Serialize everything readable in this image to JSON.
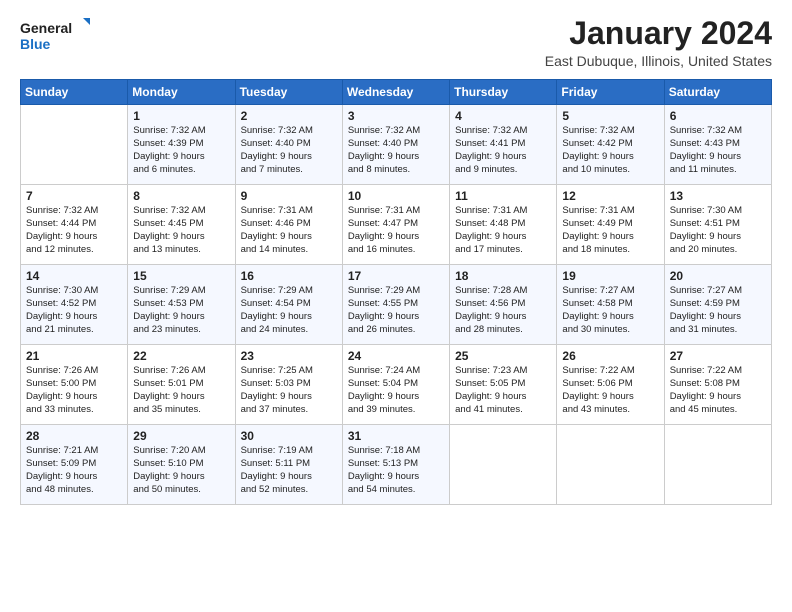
{
  "header": {
    "logo_line1": "General",
    "logo_line2": "Blue",
    "title": "January 2024",
    "subtitle": "East Dubuque, Illinois, United States"
  },
  "weekdays": [
    "Sunday",
    "Monday",
    "Tuesday",
    "Wednesday",
    "Thursday",
    "Friday",
    "Saturday"
  ],
  "weeks": [
    [
      {
        "day": "",
        "info": ""
      },
      {
        "day": "1",
        "info": "Sunrise: 7:32 AM\nSunset: 4:39 PM\nDaylight: 9 hours\nand 6 minutes."
      },
      {
        "day": "2",
        "info": "Sunrise: 7:32 AM\nSunset: 4:40 PM\nDaylight: 9 hours\nand 7 minutes."
      },
      {
        "day": "3",
        "info": "Sunrise: 7:32 AM\nSunset: 4:40 PM\nDaylight: 9 hours\nand 8 minutes."
      },
      {
        "day": "4",
        "info": "Sunrise: 7:32 AM\nSunset: 4:41 PM\nDaylight: 9 hours\nand 9 minutes."
      },
      {
        "day": "5",
        "info": "Sunrise: 7:32 AM\nSunset: 4:42 PM\nDaylight: 9 hours\nand 10 minutes."
      },
      {
        "day": "6",
        "info": "Sunrise: 7:32 AM\nSunset: 4:43 PM\nDaylight: 9 hours\nand 11 minutes."
      }
    ],
    [
      {
        "day": "7",
        "info": "Sunrise: 7:32 AM\nSunset: 4:44 PM\nDaylight: 9 hours\nand 12 minutes."
      },
      {
        "day": "8",
        "info": "Sunrise: 7:32 AM\nSunset: 4:45 PM\nDaylight: 9 hours\nand 13 minutes."
      },
      {
        "day": "9",
        "info": "Sunrise: 7:31 AM\nSunset: 4:46 PM\nDaylight: 9 hours\nand 14 minutes."
      },
      {
        "day": "10",
        "info": "Sunrise: 7:31 AM\nSunset: 4:47 PM\nDaylight: 9 hours\nand 16 minutes."
      },
      {
        "day": "11",
        "info": "Sunrise: 7:31 AM\nSunset: 4:48 PM\nDaylight: 9 hours\nand 17 minutes."
      },
      {
        "day": "12",
        "info": "Sunrise: 7:31 AM\nSunset: 4:49 PM\nDaylight: 9 hours\nand 18 minutes."
      },
      {
        "day": "13",
        "info": "Sunrise: 7:30 AM\nSunset: 4:51 PM\nDaylight: 9 hours\nand 20 minutes."
      }
    ],
    [
      {
        "day": "14",
        "info": "Sunrise: 7:30 AM\nSunset: 4:52 PM\nDaylight: 9 hours\nand 21 minutes."
      },
      {
        "day": "15",
        "info": "Sunrise: 7:29 AM\nSunset: 4:53 PM\nDaylight: 9 hours\nand 23 minutes."
      },
      {
        "day": "16",
        "info": "Sunrise: 7:29 AM\nSunset: 4:54 PM\nDaylight: 9 hours\nand 24 minutes."
      },
      {
        "day": "17",
        "info": "Sunrise: 7:29 AM\nSunset: 4:55 PM\nDaylight: 9 hours\nand 26 minutes."
      },
      {
        "day": "18",
        "info": "Sunrise: 7:28 AM\nSunset: 4:56 PM\nDaylight: 9 hours\nand 28 minutes."
      },
      {
        "day": "19",
        "info": "Sunrise: 7:27 AM\nSunset: 4:58 PM\nDaylight: 9 hours\nand 30 minutes."
      },
      {
        "day": "20",
        "info": "Sunrise: 7:27 AM\nSunset: 4:59 PM\nDaylight: 9 hours\nand 31 minutes."
      }
    ],
    [
      {
        "day": "21",
        "info": "Sunrise: 7:26 AM\nSunset: 5:00 PM\nDaylight: 9 hours\nand 33 minutes."
      },
      {
        "day": "22",
        "info": "Sunrise: 7:26 AM\nSunset: 5:01 PM\nDaylight: 9 hours\nand 35 minutes."
      },
      {
        "day": "23",
        "info": "Sunrise: 7:25 AM\nSunset: 5:03 PM\nDaylight: 9 hours\nand 37 minutes."
      },
      {
        "day": "24",
        "info": "Sunrise: 7:24 AM\nSunset: 5:04 PM\nDaylight: 9 hours\nand 39 minutes."
      },
      {
        "day": "25",
        "info": "Sunrise: 7:23 AM\nSunset: 5:05 PM\nDaylight: 9 hours\nand 41 minutes."
      },
      {
        "day": "26",
        "info": "Sunrise: 7:22 AM\nSunset: 5:06 PM\nDaylight: 9 hours\nand 43 minutes."
      },
      {
        "day": "27",
        "info": "Sunrise: 7:22 AM\nSunset: 5:08 PM\nDaylight: 9 hours\nand 45 minutes."
      }
    ],
    [
      {
        "day": "28",
        "info": "Sunrise: 7:21 AM\nSunset: 5:09 PM\nDaylight: 9 hours\nand 48 minutes."
      },
      {
        "day": "29",
        "info": "Sunrise: 7:20 AM\nSunset: 5:10 PM\nDaylight: 9 hours\nand 50 minutes."
      },
      {
        "day": "30",
        "info": "Sunrise: 7:19 AM\nSunset: 5:11 PM\nDaylight: 9 hours\nand 52 minutes."
      },
      {
        "day": "31",
        "info": "Sunrise: 7:18 AM\nSunset: 5:13 PM\nDaylight: 9 hours\nand 54 minutes."
      },
      {
        "day": "",
        "info": ""
      },
      {
        "day": "",
        "info": ""
      },
      {
        "day": "",
        "info": ""
      }
    ]
  ]
}
